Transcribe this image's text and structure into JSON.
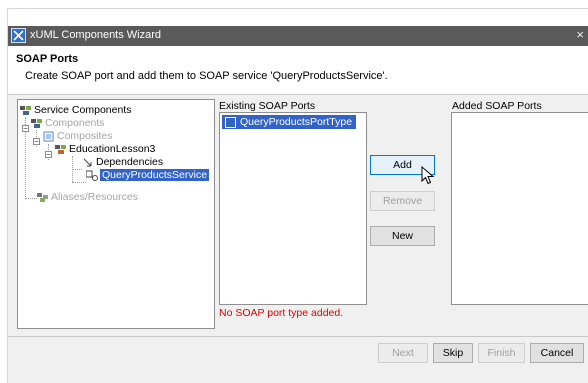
{
  "window": {
    "title": "xUML Components Wizard",
    "close_glyph": "×"
  },
  "header": {
    "title": "SOAP Ports",
    "description": "Create SOAP port and add them to SOAP service 'QueryProductsService'."
  },
  "tree": {
    "items": [
      {
        "label": "Service Components"
      },
      {
        "label": "Components"
      },
      {
        "label": "Composites"
      },
      {
        "label": "EducationLesson3"
      },
      {
        "label": "Dependencies"
      },
      {
        "label": "QueryProductsService"
      },
      {
        "label": "Aliases/Resources"
      }
    ]
  },
  "existing": {
    "header": "Existing SOAP Ports",
    "items": [
      "QueryProductsPortType"
    ]
  },
  "added": {
    "header": "Added SOAP Ports"
  },
  "buttons": {
    "add": "Add",
    "remove": "Remove",
    "new": "New"
  },
  "error": "No SOAP port type added.",
  "footer": {
    "next": "Next",
    "skip": "Skip",
    "finish": "Finish",
    "cancel": "Cancel"
  },
  "colors": {
    "titlebar": "#5a5a5a",
    "selection": "#3163c8",
    "error": "#e00000"
  }
}
